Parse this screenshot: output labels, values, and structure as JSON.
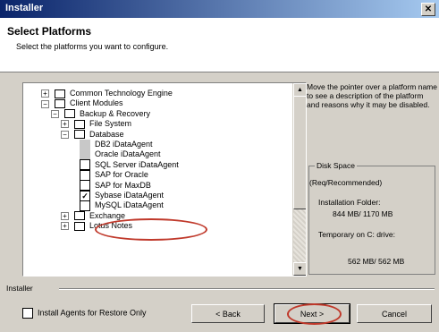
{
  "window": {
    "title": "Installer",
    "close_glyph": "✕"
  },
  "header": {
    "title": "Select Platforms",
    "subtitle": "Select the platforms you want to configure."
  },
  "tree": {
    "items": [
      {
        "label": "Common Technology Engine",
        "expander": "+",
        "folder": true,
        "indent": 0
      },
      {
        "label": "Client Modules",
        "expander": "−",
        "folder": true,
        "indent": 0
      },
      {
        "label": "Backup & Recovery",
        "expander": "−",
        "folder": true,
        "indent": 1
      },
      {
        "label": "File System",
        "expander": "+",
        "folder": true,
        "indent": 2
      },
      {
        "label": "Database",
        "expander": "−",
        "folder": true,
        "indent": 2
      },
      {
        "label": "DB2 iDataAgent",
        "checkbox": "disabled",
        "indent": 3
      },
      {
        "label": "Oracle iDataAgent",
        "checkbox": "disabled",
        "indent": 3
      },
      {
        "label": "SQL Server iDataAgent",
        "checkbox": "unchecked",
        "indent": 3
      },
      {
        "label": "SAP for Oracle",
        "checkbox": "unchecked",
        "indent": 3
      },
      {
        "label": "SAP for MaxDB",
        "checkbox": "unchecked",
        "indent": 3
      },
      {
        "label": "Sybase iDataAgent",
        "checkbox": "checked",
        "indent": 3
      },
      {
        "label": "MySQL iDataAgent",
        "checkbox": "unchecked",
        "indent": 3
      },
      {
        "label": "Exchange",
        "expander": "+",
        "folder": true,
        "indent": 2
      },
      {
        "label": "Lotus Notes",
        "expander": "+",
        "folder": true,
        "indent": 2
      }
    ]
  },
  "info": {
    "text": "Move the pointer over a platform name to see a description of the platform and reasons why it may be disabled."
  },
  "disk": {
    "group_label": "Disk Space",
    "requirement": "(Req/Recommended)",
    "install_folder_label": "Installation Folder:",
    "install_folder_value": "844 MB/ 1170 MB",
    "temp_label": "Temporary on C: drive:",
    "temp_value": "562 MB/ 562 MB"
  },
  "footer": {
    "group_label": "Installer",
    "restore_only_label": "Install Agents for Restore Only",
    "back_label": "< Back",
    "next_label": "Next >",
    "cancel_label": "Cancel"
  },
  "colors": {
    "highlight_ring": "#c0392b",
    "title_gradient_start": "#0a246a"
  }
}
